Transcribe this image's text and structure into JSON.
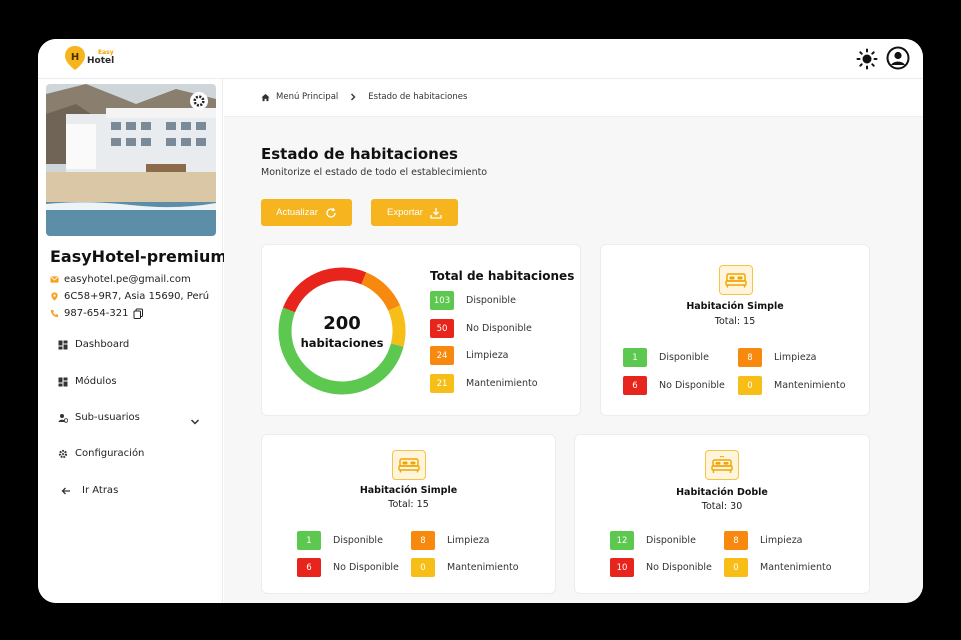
{
  "colors": {
    "available": "#5cc84f",
    "unavailable": "#e8251c",
    "cleaning": "#f7890f",
    "maintenance": "#f8be18",
    "accent": "#f6b51e"
  },
  "header": {
    "logo_text": "Hotel",
    "logo_small": "Easy",
    "logo_pin": "H"
  },
  "sidebar": {
    "hotel_name": "EasyHotel-premium",
    "email": "easyhotel.pe@gmail.com",
    "address": "6C58+9R7, Asia 15690, Perú",
    "phone": "987-654-321",
    "items": [
      {
        "label": "Dashboard",
        "icon": "dashboard-icon"
      },
      {
        "label": "Módulos",
        "icon": "modules-icon"
      },
      {
        "label": "Sub-usuarios",
        "icon": "users-icon"
      },
      {
        "label": "Configuración",
        "icon": "gear-icon"
      },
      {
        "label": "Ir Atras",
        "icon": "arrow-left-icon"
      }
    ]
  },
  "breadcrumb": {
    "home": "Menú Principal",
    "current": "Estado de habitaciones"
  },
  "page": {
    "title": "Estado de habitaciones",
    "subtitle": "Monitorize el estado de todo el establecimiento",
    "refresh_label": "Actualizar",
    "export_label": "Exportar"
  },
  "summary": {
    "total": "200",
    "total_label": "habitaciones",
    "title": "Total de habitaciones",
    "rows": [
      {
        "value": "103",
        "label": "Disponible"
      },
      {
        "value": "50",
        "label": "No Disponible"
      },
      {
        "value": "24",
        "label": "Limpieza"
      },
      {
        "value": "21",
        "label": "Mantenimiento"
      }
    ]
  },
  "rooms": [
    {
      "title": "Habitación Simple",
      "total": "Total: 15",
      "available": "1",
      "available_label": "Disponible",
      "unavailable": "6",
      "unavailable_label": "No Disponible",
      "cleaning": "8",
      "cleaning_label": "Limpieza",
      "maintenance": "0",
      "maintenance_label": "Mantenimiento"
    },
    {
      "title": "Habitación Simple",
      "total": "Total: 15",
      "available": "1",
      "available_label": "Disponible",
      "unavailable": "6",
      "unavailable_label": "No Disponible",
      "cleaning": "8",
      "cleaning_label": "Limpieza",
      "maintenance": "0",
      "maintenance_label": "Mantenimiento"
    },
    {
      "title": "Habitación Doble",
      "total": "Total: 30",
      "available": "12",
      "available_label": "Disponible",
      "unavailable": "10",
      "unavailable_label": "No Disponible",
      "cleaning": "8",
      "cleaning_label": "Limpieza",
      "maintenance": "0",
      "maintenance_label": "Mantenimiento"
    }
  ]
}
